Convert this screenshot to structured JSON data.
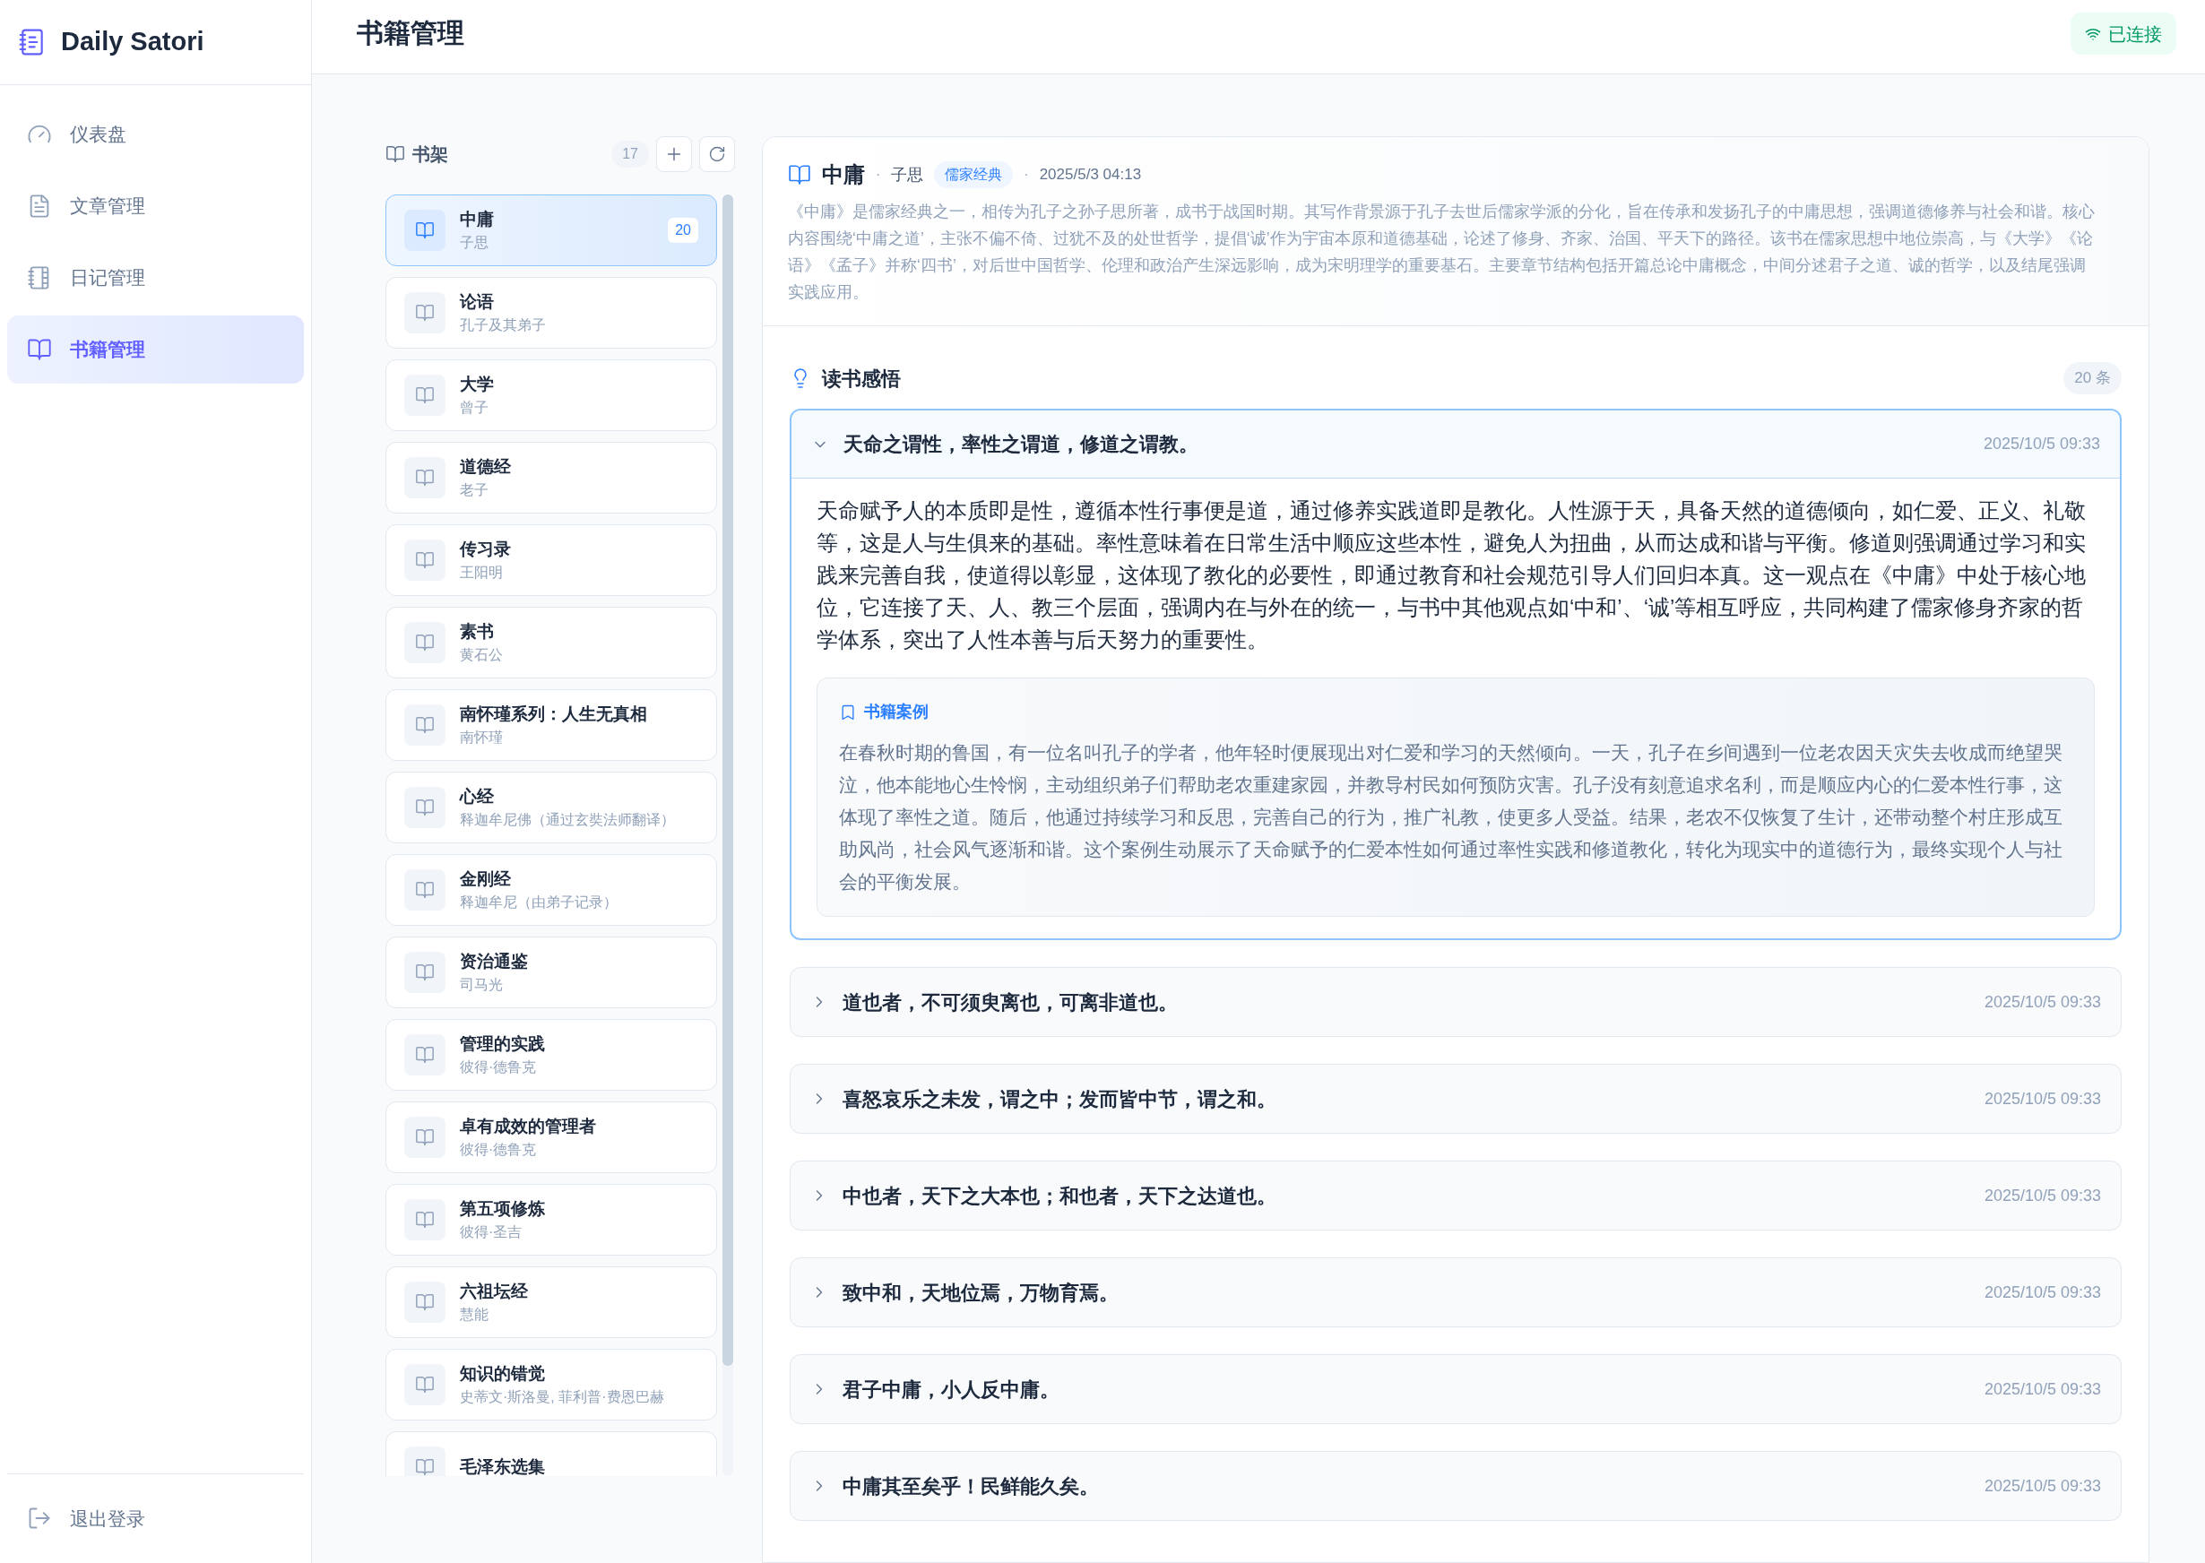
{
  "sidebar": {
    "brand": "Daily Satori",
    "nav": [
      {
        "kind": "dashboard",
        "label": "仪表盘",
        "selected": false
      },
      {
        "kind": "article",
        "label": "文章管理",
        "selected": false
      },
      {
        "kind": "diary",
        "label": "日记管理",
        "selected": false
      },
      {
        "kind": "book",
        "label": "书籍管理",
        "selected": true
      }
    ],
    "logout": "退出登录"
  },
  "header": {
    "title": "书籍管理",
    "status": "已连接"
  },
  "shelf": {
    "title": "书架",
    "count": "17",
    "books": [
      {
        "title": "中庸",
        "author": "子思",
        "count": "20",
        "selected": true
      },
      {
        "title": "论语",
        "author": "孔子及其弟子",
        "selected": false
      },
      {
        "title": "大学",
        "author": "曾子",
        "selected": false
      },
      {
        "title": "道德经",
        "author": "老子",
        "selected": false
      },
      {
        "title": "传习录",
        "author": "王阳明",
        "selected": false
      },
      {
        "title": "素书",
        "author": "黄石公",
        "selected": false
      },
      {
        "title": "南怀瑾系列：人生无真相",
        "author": "南怀瑾",
        "selected": false
      },
      {
        "title": "心经",
        "author": "释迦牟尼佛（通过玄奘法师翻译）",
        "selected": false
      },
      {
        "title": "金刚经",
        "author": "释迦牟尼（由弟子记录）",
        "selected": false
      },
      {
        "title": "资治通鉴",
        "author": "司马光",
        "selected": false
      },
      {
        "title": "管理的实践",
        "author": "彼得·德鲁克",
        "selected": false
      },
      {
        "title": "卓有成效的管理者",
        "author": "彼得·德鲁克",
        "selected": false
      },
      {
        "title": "第五项修炼",
        "author": "彼得·圣吉",
        "selected": false
      },
      {
        "title": "六祖坛经",
        "author": "慧能",
        "selected": false
      },
      {
        "title": "知识的错觉",
        "author": "史蒂文·斯洛曼, 菲利普·费恩巴赫",
        "selected": false
      },
      {
        "title": "毛泽东选集",
        "selected": false
      }
    ]
  },
  "detail": {
    "separator": "·",
    "title": "中庸",
    "author": "子思",
    "tag": "儒家经典",
    "date": "2025/5/3 04:13",
    "description": "《中庸》是儒家经典之一，相传为孔子之孙子思所著，成书于战国时期。其写作背景源于孔子去世后儒家学派的分化，旨在传承和发扬孔子的中庸思想，强调道德修养与社会和谐。核心内容围绕‘中庸之道’，主张不偏不倚、过犹不及的处世哲学，提倡‘诚’作为宇宙本原和道德基础，论述了修身、齐家、治国、平天下的路径。该书在儒家思想中地位崇高，与《大学》《论语》《孟子》并称‘四书’，对后世中国哲学、伦理和政治产生深远影响，成为宋明理学的重要基石。主要章节结构包括开篇总论中庸概念，中间分述君子之道、诚的哲学，以及结尾强调实践应用。"
  },
  "insights": {
    "title": "读书感悟",
    "count": "20 条",
    "items": [
      {
        "title": "天命之谓性，率性之谓道，修道之谓教。",
        "date": "2025/10/5 09:33",
        "expanded": true,
        "body": "天命赋予人的本质即是性，遵循本性行事便是道，通过修养实践道即是教化。人性源于天，具备天然的道德倾向，如仁爱、正义、礼敬等，这是人与生俱来的基础。率性意味着在日常生活中顺应这些本性，避免人为扭曲，从而达成和谐与平衡。修道则强调通过学习和实践来完善自我，使道得以彰显，这体现了教化的必要性，即通过教育和社会规范引导人们回归本真。这一观点在《中庸》中处于核心地位，它连接了天、人、教三个层面，强调内在与外在的统一，与书中其他观点如‘中和’、‘诚’等相互呼应，共同构建了儒家修身齐家的哲学体系，突出了人性本善与后天努力的重要性。",
        "case": {
          "label": "书籍案例",
          "text": "在春秋时期的鲁国，有一位名叫孔子的学者，他年轻时便展现出对仁爱和学习的天然倾向。一天，孔子在乡间遇到一位老农因天灾失去收成而绝望哭泣，他本能地心生怜悯，主动组织弟子们帮助老农重建家园，并教导村民如何预防灾害。孔子没有刻意追求名利，而是顺应内心的仁爱本性行事，这体现了率性之道。随后，他通过持续学习和反思，完善自己的行为，推广礼教，使更多人受益。结果，老农不仅恢复了生计，还带动整个村庄形成互助风尚，社会风气逐渐和谐。这个案例生动展示了天命赋予的仁爱本性如何通过率性实践和修道教化，转化为现实中的道德行为，最终实现个人与社会的平衡发展。"
        }
      },
      {
        "title": "道也者，不可须臾离也，可离非道也。",
        "date": "2025/10/5 09:33",
        "expanded": false
      },
      {
        "title": "喜怒哀乐之未发，谓之中；发而皆中节，谓之和。",
        "date": "2025/10/5 09:33",
        "expanded": false
      },
      {
        "title": "中也者，天下之大本也；和也者，天下之达道也。",
        "date": "2025/10/5 09:33",
        "expanded": false
      },
      {
        "title": "致中和，天地位焉，万物育焉。",
        "date": "2025/10/5 09:33",
        "expanded": false
      },
      {
        "title": "君子中庸，小人反中庸。",
        "date": "2025/10/5 09:33",
        "expanded": false
      },
      {
        "title": "中庸其至矣乎！民鲜能久矣。",
        "date": "2025/10/5 09:33",
        "expanded": false
      }
    ]
  }
}
